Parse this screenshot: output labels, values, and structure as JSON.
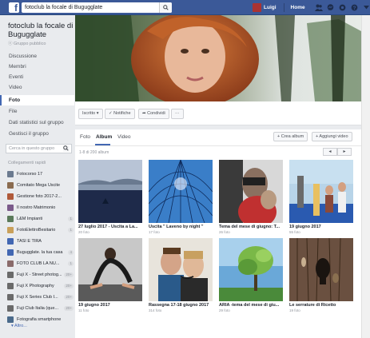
{
  "topbar": {
    "search_value": "fotoclub la focale di Bugugglate",
    "user_name": "Luigi",
    "home_label": "Home",
    "brand_color": "#3b5998",
    "icons": [
      "friends-icon",
      "messages-icon",
      "notifications-icon",
      "help-icon",
      "dropdown-icon"
    ]
  },
  "group": {
    "title": "fotoclub la focale di Bugugglate",
    "subtitle": "ⓔ Gruppo pubblico"
  },
  "nav": [
    {
      "label": "Discussione"
    },
    {
      "label": "Membri"
    },
    {
      "label": "Eventi"
    },
    {
      "label": "Video"
    },
    {
      "label": "Foto"
    },
    {
      "label": "File"
    },
    {
      "label": "Dati statistici sul gruppo"
    },
    {
      "label": "Gestisci il gruppo"
    }
  ],
  "sidebar_search": {
    "placeholder": "Cerca in questo gruppo"
  },
  "shortcuts": {
    "heading": "Collegamenti rapidi",
    "items": [
      {
        "label": "Fotocorso 17",
        "count": "",
        "color": "#6b7a8f"
      },
      {
        "label": "Comitato Mega Uscite",
        "count": "",
        "color": "#8a6b4f"
      },
      {
        "label": "Gestione foto 2017-2...",
        "count": "",
        "color": "#b05a3a"
      },
      {
        "label": "Il nostro Matrimonio",
        "count": "",
        "color": "#7a5a8a"
      },
      {
        "label": "L&M Impianti",
        "count": "1",
        "color": "#5a7a5a"
      },
      {
        "label": "FotoElettroBesitario",
        "count": "1",
        "color": "#c9a05a"
      },
      {
        "label": "TASI E TIRA",
        "count": "",
        "color": "#4267b2"
      },
      {
        "label": "Bugugglate. la tua casa",
        "count": "4",
        "color": "#4267b2"
      },
      {
        "label": "FOTO CLUB LA NU...",
        "count": "1",
        "color": "#8a6b6b"
      },
      {
        "label": "Fuji X - Street photog...",
        "count": "20+",
        "color": "#6a6a6a"
      },
      {
        "label": "Fuji X Photography",
        "count": "20+",
        "color": "#6a6a6a"
      },
      {
        "label": "Fuji X Series Club I...",
        "count": "20+",
        "color": "#6a6a6a"
      },
      {
        "label": "Fuji Club Italia (que...",
        "count": "20+",
        "color": "#6a6a6a"
      },
      {
        "label": "Fotografia smartphone",
        "count": "",
        "color": "#4a6a8a"
      }
    ],
    "more_label": "Altro..."
  },
  "actions": {
    "joined_label": "Iscritto ▾",
    "notifications_label": "✓ Notifiche",
    "share_label": "➦ Condividi",
    "more_label": "···"
  },
  "photos": {
    "tabs": [
      "Foto",
      "Album",
      "Video"
    ],
    "active_tab": "Album",
    "create_album": "+ Crea album",
    "add_video": "+ Aggiungi video",
    "count_text": "1-8 di 200 album",
    "prev": "◂",
    "next": "▸",
    "albums": [
      {
        "title": "27 luglio 2017 - Uscita a La...",
        "count": "20 foto",
        "scene": "lake"
      },
      {
        "title": "Uscita \" Laveno by night \"",
        "count": "17 foto",
        "scene": "dome"
      },
      {
        "title": "Tema del mese di giugno: T...",
        "count": "26 foto",
        "scene": "bw-girl"
      },
      {
        "title": "19 giugno 2017",
        "count": "55 foto",
        "scene": "park"
      },
      {
        "title": "19 giugno 2017",
        "count": "11 foto",
        "scene": "dance"
      },
      {
        "title": "Rassegna 17-18 giugno 2017",
        "count": "314 foto",
        "scene": "selfie"
      },
      {
        "title": "ARIA -tema del mese di giu...",
        "count": "29 foto",
        "scene": "tree"
      },
      {
        "title": "Le serrature di Ricetto",
        "count": "19 foto",
        "scene": "door"
      }
    ]
  }
}
